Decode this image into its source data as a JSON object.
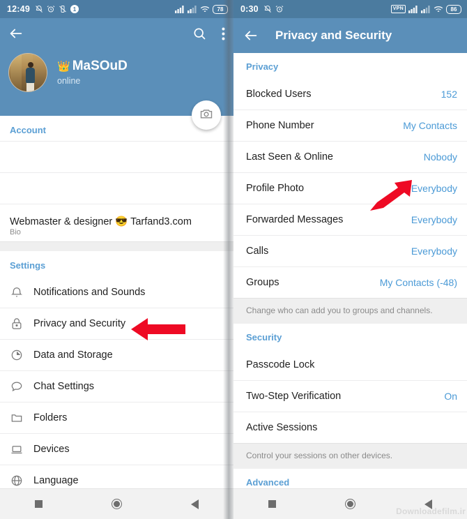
{
  "left": {
    "status_bar": {
      "time": "12:49",
      "icons": [
        "mute-icon",
        "alarm-icon",
        "vibrate-icon",
        "notification-count-icon"
      ],
      "notification_count": "1",
      "signal_icons": [
        "signal-bars-icon",
        "signal-bars-icon",
        "wifi-icon"
      ],
      "battery": "78"
    },
    "header": {
      "back_icon": "back-arrow-icon",
      "search_icon": "search-icon",
      "menu_icon": "more-vertical-icon",
      "avatar": "profile-avatar",
      "crown": "👑",
      "name": "MaSOuD",
      "status": "online",
      "camera_icon": "camera-icon"
    },
    "account_section": {
      "title": "Account"
    },
    "bio": {
      "text": "Webmaster & designer 😎 Tarfand3.com",
      "label": "Bio"
    },
    "settings_section": {
      "title": "Settings"
    },
    "settings_items": [
      {
        "label": "Notifications and Sounds",
        "icon": "bell-icon"
      },
      {
        "label": "Privacy and Security",
        "icon": "lock-icon"
      },
      {
        "label": "Data and Storage",
        "icon": "pie-clock-icon"
      },
      {
        "label": "Chat Settings",
        "icon": "chat-bubble-icon"
      },
      {
        "label": "Folders",
        "icon": "folder-icon"
      },
      {
        "label": "Devices",
        "icon": "laptop-icon"
      },
      {
        "label": "Language",
        "icon": "globe-icon"
      }
    ],
    "nav": {
      "recents": "square-icon",
      "home": "circle-icon",
      "back": "triangle-back-icon"
    }
  },
  "right": {
    "status_bar": {
      "time": "0:30",
      "icons": [
        "mute-icon",
        "alarm-icon"
      ],
      "vpn": "VPN",
      "signal_icons": [
        "signal-bars-icon",
        "signal-bars-icon",
        "wifi-icon"
      ],
      "battery": "86"
    },
    "header": {
      "back_icon": "back-arrow-icon",
      "title": "Privacy and Security"
    },
    "privacy_section": {
      "title": "Privacy"
    },
    "privacy_items": [
      {
        "label": "Blocked Users",
        "value": "152"
      },
      {
        "label": "Phone Number",
        "value": "My Contacts"
      },
      {
        "label": "Last Seen & Online",
        "value": "Nobody"
      },
      {
        "label": "Profile Photo",
        "value": "Everybody"
      },
      {
        "label": "Forwarded Messages",
        "value": "Everybody"
      },
      {
        "label": "Calls",
        "value": "Everybody"
      },
      {
        "label": "Groups",
        "value": "My Contacts (-48)"
      }
    ],
    "privacy_hint": "Change who can add you to groups and channels.",
    "security_section": {
      "title": "Security"
    },
    "security_items": [
      {
        "label": "Passcode Lock",
        "value": ""
      },
      {
        "label": "Two-Step Verification",
        "value": "On"
      },
      {
        "label": "Active Sessions",
        "value": ""
      }
    ],
    "security_hint": "Control your sessions on other devices.",
    "advanced_section": {
      "title": "Advanced"
    },
    "nav": {
      "recents": "square-icon",
      "home": "circle-icon",
      "back": "triangle-back-icon"
    }
  },
  "annotations": {
    "arrow_left": "red-arrow-pointing-left",
    "arrow_right": "red-arrow-pointing-up-right",
    "arrow_color": "#ee0a24"
  },
  "watermark": "Downloadefilm.ir"
}
